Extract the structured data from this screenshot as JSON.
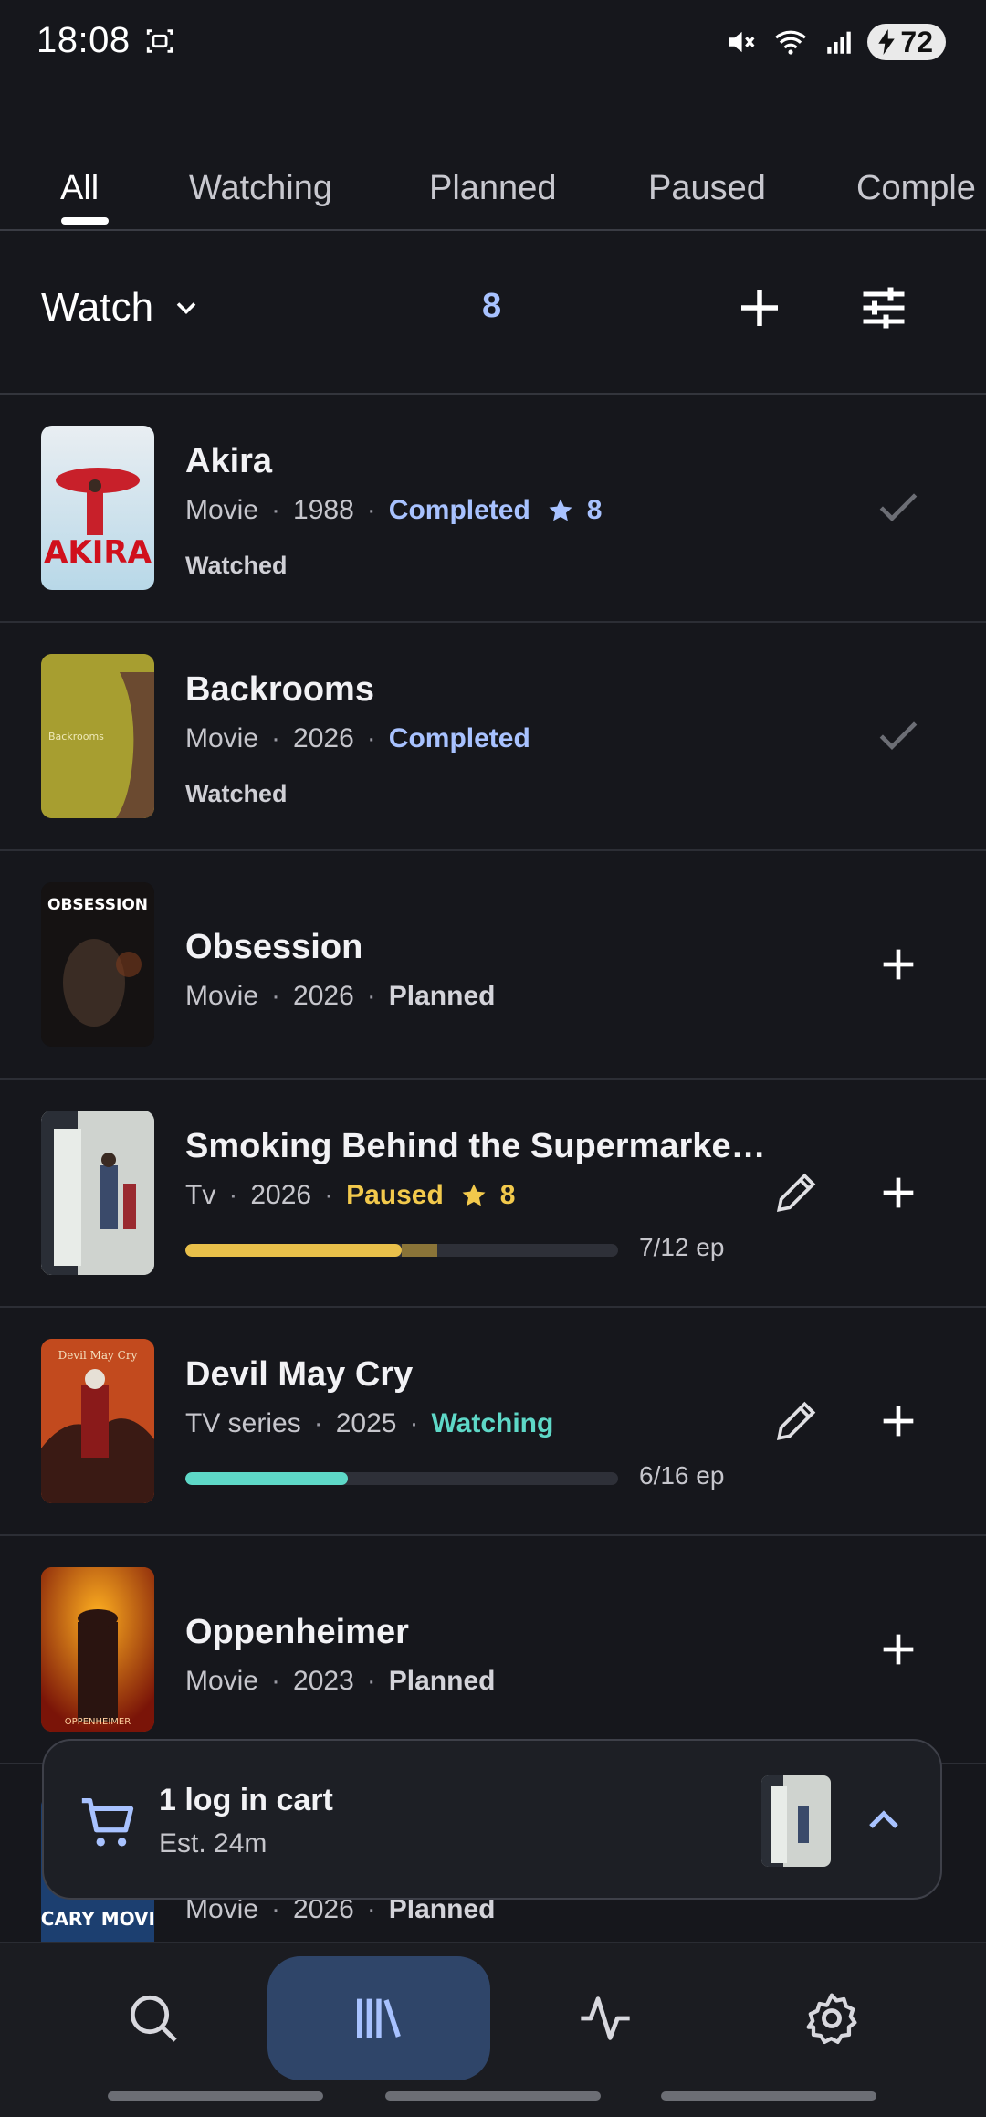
{
  "status_bar": {
    "time": "18:08",
    "battery": "72"
  },
  "tabs": [
    {
      "label": "All",
      "active": true
    },
    {
      "label": "Watching",
      "active": false
    },
    {
      "label": "Planned",
      "active": false
    },
    {
      "label": "Paused",
      "active": false
    },
    {
      "label": "Comple",
      "active": false
    }
  ],
  "toolbar": {
    "media_type": "Watch",
    "count": "8"
  },
  "items": [
    {
      "title": "Akira",
      "type": "Movie",
      "year": "1988",
      "status": "Completed",
      "rating": "8",
      "sub": "Watched",
      "poster_text": "AKIRA"
    },
    {
      "title": "Backrooms",
      "type": "Movie",
      "year": "2026",
      "status": "Completed",
      "sub": "Watched",
      "poster_text": "Backrooms"
    },
    {
      "title": "Obsession",
      "type": "Movie",
      "year": "2026",
      "status": "Planned",
      "poster_text": "OBSESSION"
    },
    {
      "title": "Smoking Behind the Supermarke…",
      "type": "Tv",
      "year": "2026",
      "status": "Paused",
      "rating": "8",
      "progress": 0.5,
      "progress_pending": 0.583,
      "progress_label": "7/12 ep"
    },
    {
      "title": "Devil May Cry",
      "type": "TV series",
      "year": "2025",
      "status": "Watching",
      "progress": 0.375,
      "progress_label": "6/16 ep",
      "poster_text": "Devil May Cry"
    },
    {
      "title": "Oppenheimer",
      "type": "Movie",
      "year": "2023",
      "status": "Planned",
      "poster_text": "OPPENHEIMER"
    },
    {
      "title": "",
      "type": "Movie",
      "year": "2026",
      "status": "Planned",
      "poster_text": "SCARY MOVIE"
    }
  ],
  "cart": {
    "title": "1 log in cart",
    "subtitle": "Est. 24m"
  },
  "colors": {
    "accent": "#a8c2ff",
    "paused": "#f2c94c",
    "watching": "#5ed8c7",
    "nav_active_bg": "#2f4569"
  }
}
